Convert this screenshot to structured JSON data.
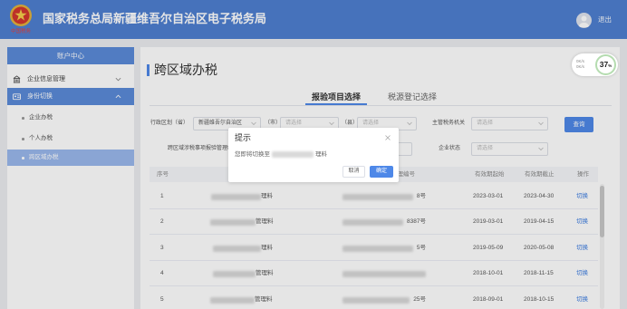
{
  "colors": {
    "header_bg": "#4e7fd1",
    "primary": "#4e88e8",
    "link": "#3a7be0",
    "sidebar_active": "#5b8bd9",
    "sidebar_sub_active": "#9ab8ec"
  },
  "header": {
    "title": "国家税务总局新疆维吾尔自治区电子税务局",
    "emblem_text": "中国税务",
    "logout": "退出",
    "avatar_icon": "user-icon"
  },
  "sidebar": {
    "heading": "账户中心",
    "items": [
      {
        "label": "企业信息管理",
        "icon": "building-icon",
        "chevron": "chevron-down-icon",
        "active": false
      },
      {
        "label": "身份切换",
        "icon": "id-card-icon",
        "chevron": "chevron-up-icon",
        "active": true
      }
    ],
    "sub_items": [
      {
        "label": "企业办税",
        "active": false
      },
      {
        "label": "个人办税",
        "active": false
      },
      {
        "label": "跨区域办税",
        "active": true
      }
    ]
  },
  "main": {
    "title": "跨区域办税",
    "tabs": [
      {
        "label": "报验项目选择",
        "active": true
      },
      {
        "label": "税源登记选择",
        "active": false
      }
    ],
    "filters": {
      "province": {
        "label": "行政区划（省）",
        "value": "新疆维吾尔自治区"
      },
      "city": {
        "label": "（市）",
        "placeholder": "请选择"
      },
      "county": {
        "label": "（县）",
        "placeholder": "请选择"
      },
      "tax_authority": {
        "label": "主管税务机关",
        "placeholder": "请选择"
      },
      "report_number": {
        "label": "跨区域涉税事项报验管理编号"
      },
      "status": {
        "label": "企业状态",
        "placeholder": "请选择"
      },
      "search_button": "查询"
    },
    "table": {
      "headers": {
        "index": "序号",
        "number": "管理编号",
        "start": "有效期起始",
        "end": "有效期截止",
        "action": "操作"
      },
      "rows": [
        {
          "index": "1",
          "name_suffix": "理料",
          "number_suffix": "8号",
          "start": "2023-03-01",
          "end": "2023-04-30",
          "action": "切换"
        },
        {
          "index": "2",
          "name_suffix": "管理料",
          "number_suffix": "8387号",
          "start": "2019-03-01",
          "end": "2019-04-15",
          "action": "切换"
        },
        {
          "index": "3",
          "name_suffix": "理料",
          "number_suffix": "5号",
          "start": "2019-05-09",
          "end": "2020-05-08",
          "action": "切换"
        },
        {
          "index": "4",
          "name_suffix": "管理料",
          "start": "2018-10-01",
          "end": "2018-11-15",
          "action": "切换"
        },
        {
          "index": "5",
          "name_suffix": "管理料",
          "number_suffix": "25号",
          "start": "2018-09-01",
          "end": "2018-10-15",
          "action": "切换"
        }
      ]
    }
  },
  "modal": {
    "title": "提示",
    "message_prefix": "您即将切换至",
    "message_suffix": "理料",
    "cancel": "取消",
    "confirm": "确定"
  },
  "net_badge": {
    "percent": "37",
    "unit": "%",
    "upload": "0K/s",
    "download": "0K/s"
  }
}
